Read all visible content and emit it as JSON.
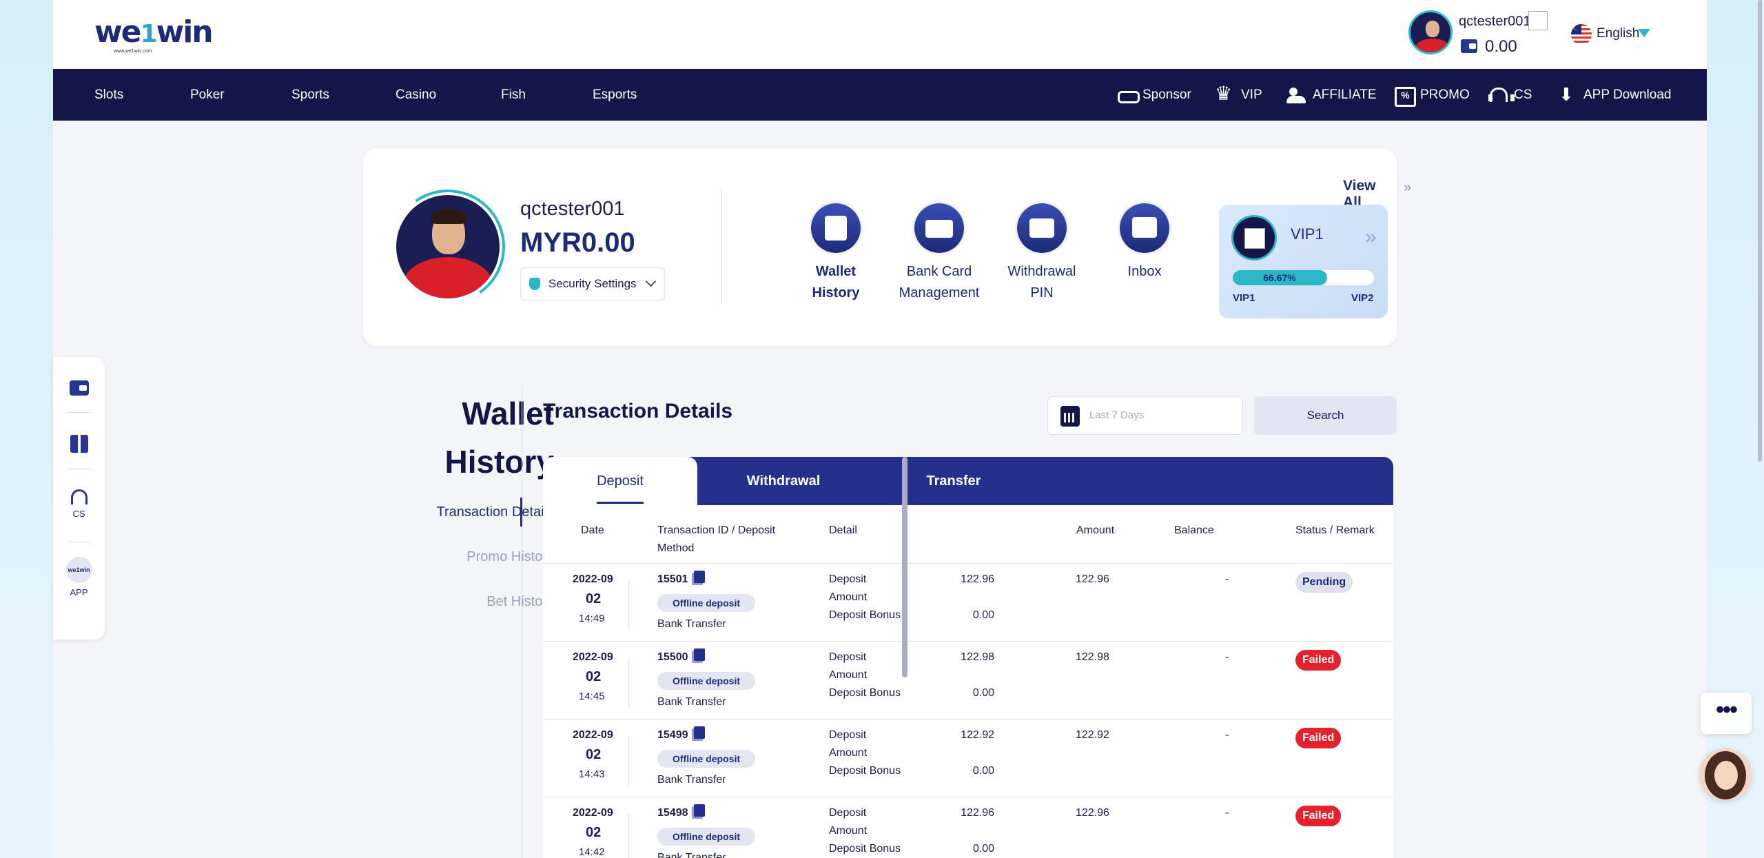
{
  "header": {
    "logo_text": "we1win",
    "logo_sub": "www.we1win.com",
    "username": "qctester001",
    "balance": "0.00",
    "language": "English"
  },
  "nav": {
    "left": [
      "Slots",
      "Poker",
      "Sports",
      "Casino",
      "Fish",
      "Esports"
    ],
    "right": [
      {
        "label": "Sponsor",
        "icon": "sponsor-icon"
      },
      {
        "label": "VIP",
        "icon": "crown-icon"
      },
      {
        "label": "AFFILIATE",
        "icon": "affiliate-icon"
      },
      {
        "label": "PROMO",
        "icon": "promo-icon"
      },
      {
        "label": "CS",
        "icon": "headset-icon"
      },
      {
        "label": "APP Download",
        "icon": "download-icon"
      }
    ]
  },
  "profile": {
    "username": "qctester001",
    "balance": "MYR0.00",
    "security_label": "Security Settings",
    "quick_links": [
      {
        "label": "Wallet History",
        "icon": "document-icon"
      },
      {
        "label": "Bank Card Management",
        "icon": "bank-card-icon"
      },
      {
        "label": "Withdrawal PIN",
        "icon": "pin-icon"
      },
      {
        "label": "Inbox",
        "icon": "inbox-icon"
      }
    ],
    "view_all": "View All",
    "vip": {
      "level": "VIP1",
      "progress_text": "66.67%",
      "progress": 66.67,
      "min_label": "VIP1",
      "max_label": "VIP2"
    }
  },
  "float_bar": {
    "items": [
      {
        "label": "",
        "icon": "wallet-icon"
      },
      {
        "label": "",
        "icon": "gift-icon"
      },
      {
        "label": "CS",
        "icon": "headset-icon"
      },
      {
        "label": "APP",
        "icon": "app-logo-icon"
      }
    ]
  },
  "sidebar": {
    "title_line1": "Wallet",
    "title_line2": "History",
    "links": [
      "Transaction Details",
      "Promo History",
      "Bet History"
    ],
    "active": "Transaction Details"
  },
  "main": {
    "title": "Transaction Details",
    "date_placeholder": "Last 7 Days",
    "search_label": "Search",
    "tabs": [
      "Deposit",
      "Withdrawal",
      "Transfer"
    ],
    "active_tab": "Deposit",
    "columns": {
      "date": "Date",
      "txid_line1": "Transaction ID / Deposit",
      "txid_line2": "Method",
      "detail": "Detail",
      "amount": "Amount",
      "balance": "Balance",
      "status": "Status / Remark"
    },
    "rows": [
      {
        "date": "2022-09",
        "day": "02",
        "time": "14:49",
        "id": "15501",
        "type": "Offline deposit",
        "method": "Bank Transfer",
        "detail1": "Deposit",
        "detail2": "Amount",
        "detail3": "Deposit Bonus",
        "v1": "122.96",
        "v2": "0.00",
        "amount": "122.96",
        "balance": "-",
        "status": "Pending"
      },
      {
        "date": "2022-09",
        "day": "02",
        "time": "14:45",
        "id": "15500",
        "type": "Offline deposit",
        "method": "Bank Transfer",
        "detail1": "Deposit",
        "detail2": "Amount",
        "detail3": "Deposit Bonus",
        "v1": "122.98",
        "v2": "0.00",
        "amount": "122.98",
        "balance": "-",
        "status": "Failed"
      },
      {
        "date": "2022-09",
        "day": "02",
        "time": "14:43",
        "id": "15499",
        "type": "Offline deposit",
        "method": "Bank Transfer",
        "detail1": "Deposit",
        "detail2": "Amount",
        "detail3": "Deposit Bonus",
        "v1": "122.92",
        "v2": "0.00",
        "amount": "122.92",
        "balance": "-",
        "status": "Failed"
      },
      {
        "date": "2022-09",
        "day": "02",
        "time": "14:42",
        "id": "15498",
        "type": "Offline deposit",
        "method": "Bank Transfer",
        "detail1": "Deposit",
        "detail2": "Amount",
        "detail3": "Deposit Bonus",
        "v1": "122.96",
        "v2": "0.00",
        "amount": "122.96",
        "balance": "-",
        "status": "Failed"
      }
    ]
  },
  "colors": {
    "navy": "#14164a",
    "accent": "#2ab7c8",
    "tab_bar": "#23308c",
    "failed": "#e4212c"
  }
}
